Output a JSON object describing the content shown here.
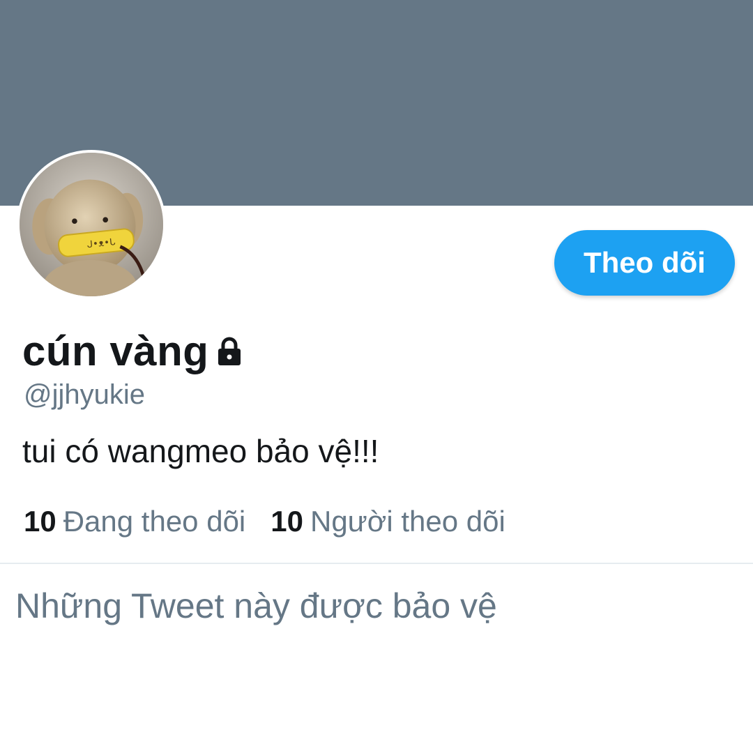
{
  "profile": {
    "display_name": "cún vàng",
    "handle": "@jjhyukie",
    "bio": "tui có wangmeo bảo vệ!!!",
    "protected": true,
    "lock_icon": "lock-icon",
    "banner_color": "#657786",
    "avatar_description": "plush puppy with yellow bandage"
  },
  "actions": {
    "follow_label": "Theo dõi",
    "follow_color": "#1da1f2"
  },
  "stats": {
    "following_count": "10",
    "following_label": "Đang theo dõi",
    "followers_count": "10",
    "followers_label": "Người theo dõi"
  },
  "timeline": {
    "protected_message": "Những Tweet này được bảo vệ"
  }
}
